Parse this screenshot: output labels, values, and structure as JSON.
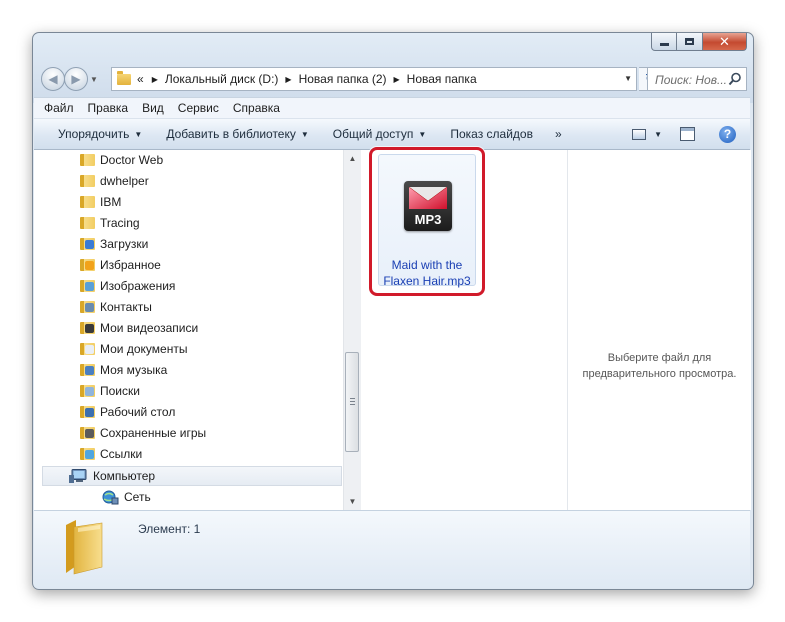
{
  "window": {
    "address": {
      "prefix": "«",
      "crumbs": [
        "Локальный диск (D:)",
        "Новая папка (2)",
        "Новая папка"
      ]
    },
    "search": {
      "placeholder": "Поиск: Нов..."
    }
  },
  "menu": {
    "items": [
      "Файл",
      "Правка",
      "Вид",
      "Сервис",
      "Справка"
    ]
  },
  "toolbar": {
    "organize": "Упорядочить",
    "add_to_library": "Добавить в библиотеку",
    "share": "Общий доступ",
    "slideshow": "Показ слайдов",
    "more": "»",
    "help_glyph": "?"
  },
  "nav_pane": {
    "folders": [
      "Doctor Web",
      "dwhelper",
      "IBM",
      "Tracing",
      "Загрузки",
      "Избранное",
      "Изображения",
      "Контакты",
      "Мои видеозаписи",
      "Мои документы",
      "Моя музыка",
      "Поиски",
      "Рабочий стол",
      "Сохраненные игры",
      "Ссылки"
    ],
    "computer": "Компьютер",
    "network": "Сеть"
  },
  "files": [
    {
      "name_line1": "Maid with the",
      "name_line2": "Flaxen Hair.mp3",
      "type_tag": "MP3",
      "selected": true
    }
  ],
  "preview": {
    "line1": "Выберите файл для",
    "line2": "предварительного просмотра."
  },
  "details": {
    "status": "Элемент: 1"
  },
  "colors": {
    "highlight": "#d11a2a",
    "file_name": "#1a3fb3",
    "folder": "#f2cd62"
  }
}
